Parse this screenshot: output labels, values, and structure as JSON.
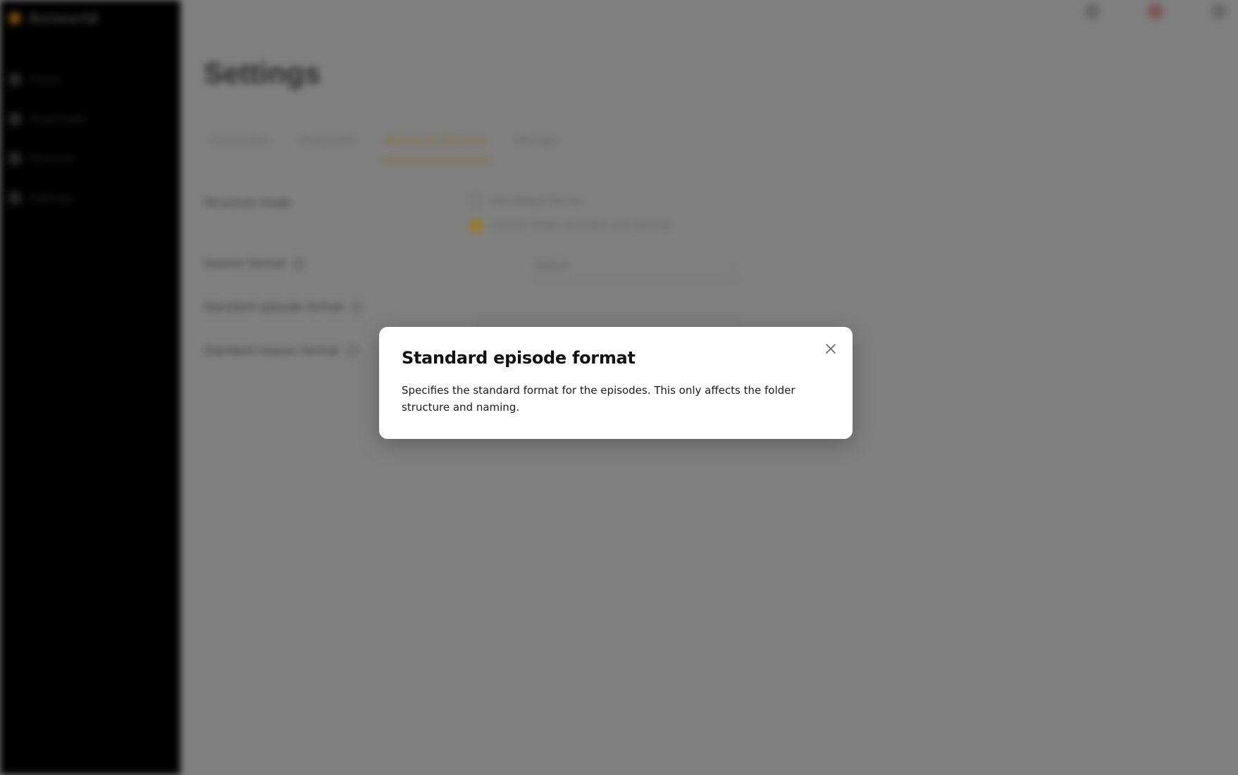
{
  "sidebar": {
    "brand": "Aniworld",
    "items": [
      {
        "label": "Home"
      },
      {
        "label": "Downloads"
      },
      {
        "label": "Discover"
      },
      {
        "label": "Settings"
      }
    ]
  },
  "page": {
    "title": "Settings",
    "tabs": [
      {
        "label": "Connection"
      },
      {
        "label": "Downloads"
      },
      {
        "label": "Naming & structure"
      },
      {
        "label": "Storage"
      }
    ],
    "rows": [
      {
        "label": "Structure mode"
      },
      {
        "label": "Season format"
      },
      {
        "label": "Standard episode format"
      },
      {
        "label": "Standard season format"
      }
    ],
    "radio_options": [
      {
        "label": "Use default format"
      },
      {
        "label": "Custom folder structure and naming"
      }
    ],
    "select_value": "Default"
  },
  "modal": {
    "title": "Standard episode format",
    "body": "Specifies the standard format for the episodes. This only affects the folder structure and naming."
  },
  "colors": {
    "accent": "#f0a020",
    "overlay": "#808080",
    "modal_bg": "#ffffff"
  }
}
